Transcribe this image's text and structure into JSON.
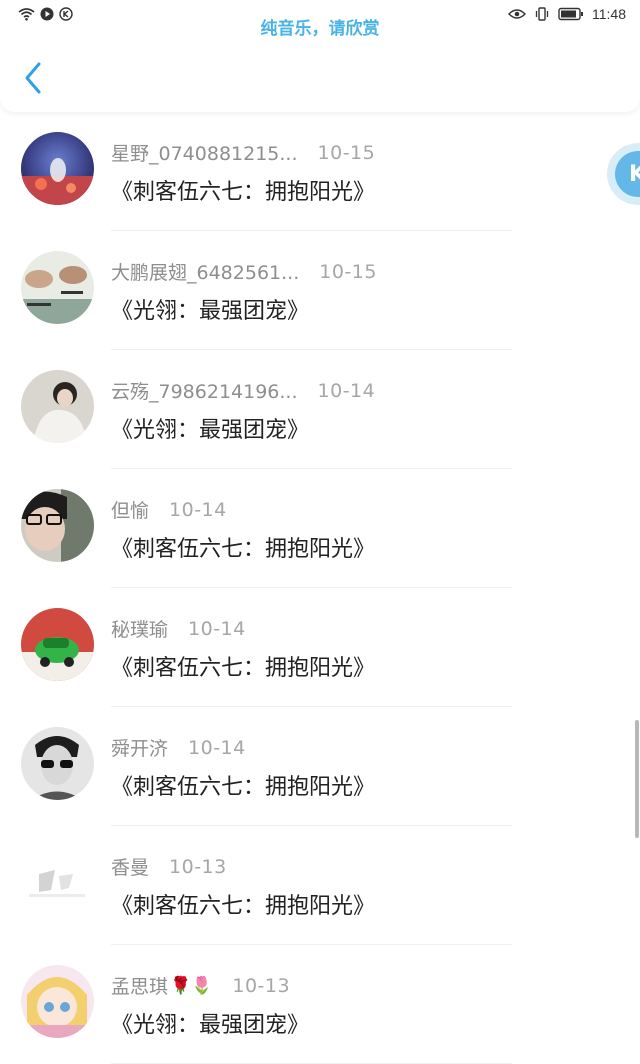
{
  "status_bar": {
    "time": "11:48",
    "icons": [
      "wifi-icon",
      "play-icon",
      "k-icon",
      "eye-icon",
      "vibrate-icon",
      "battery-icon"
    ]
  },
  "now_playing": "纯音乐，请欣赏",
  "nav": {
    "back_icon": "chevron-left-icon"
  },
  "float_button": {
    "label": "K"
  },
  "colors": {
    "accent": "#4ab3e6",
    "name": "#8e8e8e",
    "title": "#222222"
  },
  "items": [
    {
      "name": "星野_0740881215...",
      "date": "10-15",
      "title": "《刺客伍六七：拥抱阳光》"
    },
    {
      "name": "大鹏展翅_6482561...",
      "date": "10-15",
      "title": "《光翎：最强团宠》"
    },
    {
      "name": "云殇_7986214196...",
      "date": "10-14",
      "title": "《光翎：最强团宠》"
    },
    {
      "name": "但愉",
      "date": "10-14",
      "title": "《刺客伍六七：拥抱阳光》"
    },
    {
      "name": "秘璞瑜",
      "date": "10-14",
      "title": "《刺客伍六七：拥抱阳光》"
    },
    {
      "name": "舜开济",
      "date": "10-14",
      "title": "《刺客伍六七：拥抱阳光》"
    },
    {
      "name": "香曼",
      "date": "10-13",
      "title": "《刺客伍六七：拥抱阳光》"
    },
    {
      "name": "孟思琪",
      "name_suffix": "🌹🌷",
      "date": "10-13",
      "title": "《光翎：最强团宠》"
    }
  ]
}
